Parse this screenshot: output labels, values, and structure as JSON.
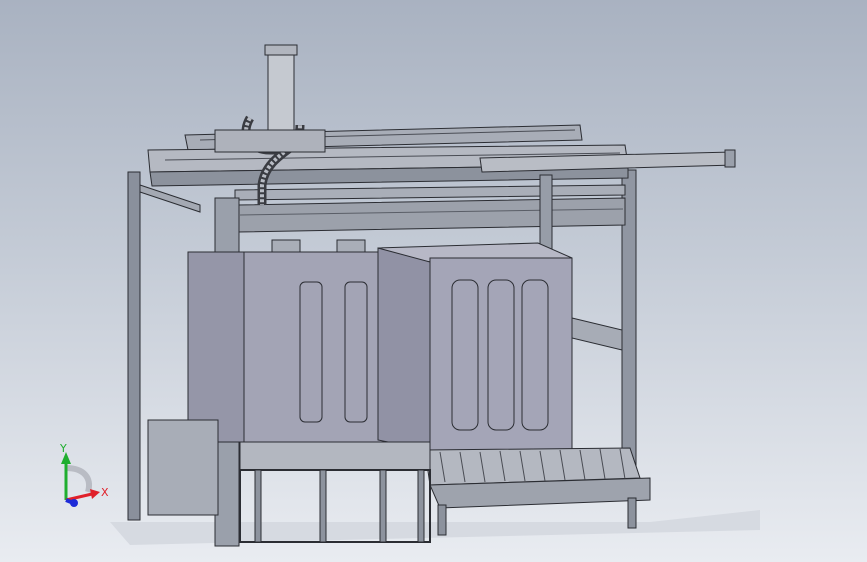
{
  "viewport": {
    "background_top": "#a9b2c1",
    "background_bottom": "#e9ecf1"
  },
  "triad": {
    "x_label": "X",
    "y_label": "Y",
    "x_color": "#e0202a",
    "y_color": "#1fae2f",
    "z_color": "#1d2bd8"
  },
  "model": {
    "frame_color": "#8f96a3",
    "panel_color": "#a2a3b4",
    "edge_color": "#2b2d33"
  }
}
